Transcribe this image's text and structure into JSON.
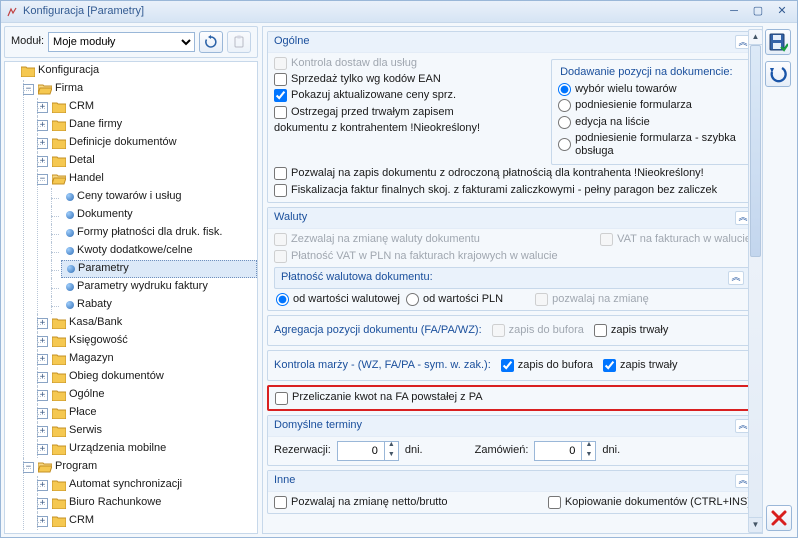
{
  "window": {
    "title": "Konfiguracja [Parametry]"
  },
  "module_row": {
    "label": "Moduł:",
    "selected": "Moje moduły"
  },
  "tree": {
    "root": "Konfiguracja",
    "firma": {
      "label": "Firma",
      "crm": "CRM",
      "dane_firmy": "Dane firmy",
      "def_dok": "Definicje dokumentów",
      "detal": "Detal",
      "handel": {
        "label": "Handel",
        "ceny": "Ceny towarów i usług",
        "dokumenty": "Dokumenty",
        "formy": "Formy płatności dla druk. fisk.",
        "kwoty": "Kwoty dodatkowe/celne",
        "parametry": "Parametry",
        "param_wydruku": "Parametry wydruku faktury",
        "rabaty": "Rabaty"
      },
      "kasa": "Kasa/Bank",
      "ksiegowosc": "Księgowość",
      "magazyn": "Magazyn",
      "obieg": "Obieg dokumentów",
      "ogolne": "Ogólne",
      "place": "Płace",
      "serwis": "Serwis",
      "urzadzenia": "Urządzenia mobilne"
    },
    "program": {
      "label": "Program",
      "automat": "Automat synchronizacji",
      "biuro": "Biuro Rachunkowe",
      "crm": "CRM"
    }
  },
  "groups": {
    "ogolne": {
      "title": "Ogólne",
      "kontrola_dostaw": "Kontrola dostaw dla usług",
      "sprzedaz_ean": "Sprzedaż tylko wg kodów EAN",
      "pokazuj_ceny": "Pokazuj aktualizowane ceny sprz.",
      "ostrzegaj_zapis": "Ostrzegaj przed trwałym zapisem",
      "ostrzegaj_zapis_note": "dokumentu z kontrahentem !Nieokreślony!",
      "dodawanie": {
        "title": "Dodawanie pozycji na dokumencie:",
        "r1": "wybór wielu towarów",
        "r2": "podniesienie formularza",
        "r3": "edycja na liście",
        "r4": "podniesienie formularza - szybka obsługa"
      },
      "pozwalaj_odroczona": "Pozwalaj na zapis dokumentu z odroczoną płatnością dla kontrahenta !Nieokreślony!",
      "fiskalizacja": "Fiskalizacja faktur finalnych skoj. z fakturami zaliczkowymi - pełny paragon bez zaliczek"
    },
    "waluty": {
      "title": "Waluty",
      "zezwalaj_zmiana": "Zezwalaj na zmianę waluty dokumentu",
      "vat_walucie": "VAT na fakturach w walucie",
      "platnosc_vat_pln": "Płatność VAT w PLN na fakturach krajowych w walucie",
      "platnosc_walutowa_title": "Płatność walutowa dokumentu:",
      "r1": "od wartości walutowej",
      "r2": "od wartości PLN",
      "pozwalaj_zmiane": "pozwalaj na zmianę"
    },
    "agregacja": {
      "label": "Agregacja pozycji dokumentu (FA/PA/WZ):",
      "zapis_bufora": "zapis do bufora",
      "zapis_trwaly": "zapis trwały"
    },
    "kontrola_marzy": {
      "label": "Kontrola marży - (WZ, FA/PA - sym. w. zak.):",
      "zapis_bufora": "zapis do bufora",
      "zapis_trwaly": "zapis trwały"
    },
    "przeliczanie": "Przeliczanie kwot na FA powstałej z PA",
    "terminy": {
      "title": "Domyślne terminy",
      "rezerwacji_label": "Rezerwacji:",
      "rezerwacji_value": "0",
      "zamowien_label": "Zamówień:",
      "zamowien_value": "0",
      "dni": "dni."
    },
    "inne": {
      "title": "Inne",
      "pozwalaj_netto": "Pozwalaj na zmianę netto/brutto",
      "kopiowanie": "Kopiowanie dokumentów (CTRL+INS)"
    }
  }
}
